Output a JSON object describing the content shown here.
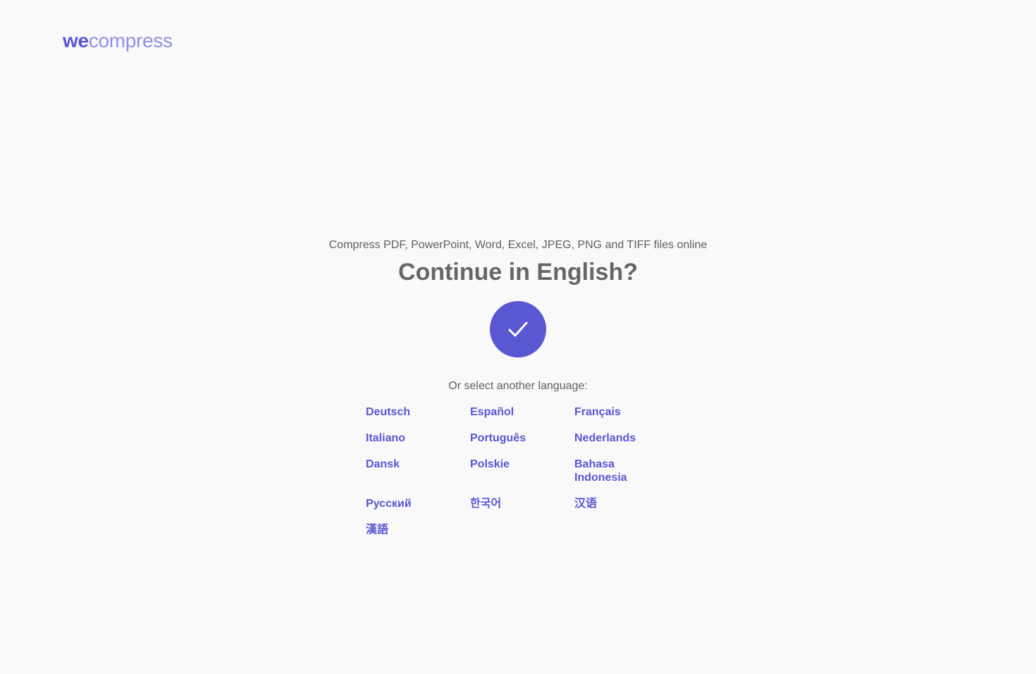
{
  "brand": {
    "we": "we",
    "compress": "compress",
    "accent": "#5a57d3",
    "accent_light": "#928fe6"
  },
  "main": {
    "tagline": "Compress PDF, PowerPoint, Word, Excel, JPEG, PNG and TIFF files online",
    "headline": "Continue in English?",
    "confirm_icon": "checkmark-icon",
    "or_label": "Or select another language:"
  },
  "languages": [
    {
      "label": "Deutsch"
    },
    {
      "label": "Español"
    },
    {
      "label": "Français"
    },
    {
      "label": "Italiano"
    },
    {
      "label": "Português"
    },
    {
      "label": "Nederlands"
    },
    {
      "label": "Dansk"
    },
    {
      "label": "Polskie"
    },
    {
      "label": "Bahasa Indonesia"
    },
    {
      "label": "Русский"
    },
    {
      "label": "한국어"
    },
    {
      "label": "汉语"
    },
    {
      "label": "漢語"
    }
  ]
}
